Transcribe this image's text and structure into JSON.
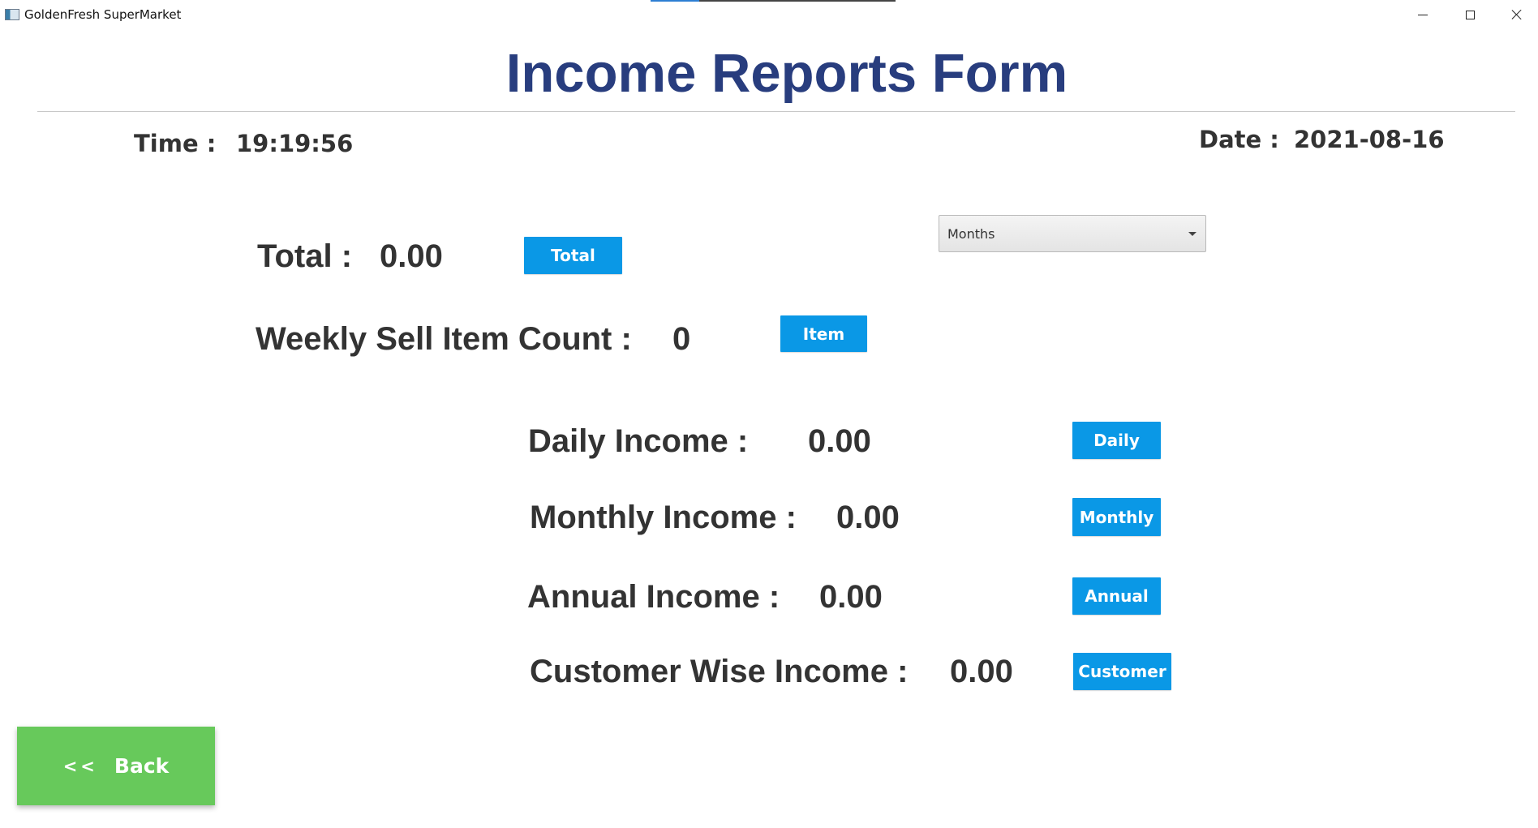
{
  "window": {
    "title": "GoldenFresh SuperMarket",
    "controls": {
      "minimize": "minimize-icon",
      "maximize": "maximize-icon",
      "close": "close-icon"
    }
  },
  "header": {
    "title": "Income Reports Form",
    "time_label": "Time  :",
    "time_value": "19:19:56",
    "date_label": "Date  :",
    "date_value": "2021-08-16"
  },
  "summary": {
    "total_label": "Total  :",
    "total_value": "0.00",
    "total_button": "Total",
    "weekly_label": "Weekly Sell Item Count :",
    "weekly_value": "0",
    "item_button": "Item"
  },
  "period_select": {
    "selected": "Months"
  },
  "income": {
    "daily_label": "Daily Income :",
    "daily_value": "0.00",
    "daily_button": "Daily",
    "monthly_label": "Monthly Income :",
    "monthly_value": "0.00",
    "monthly_button": "Monthly",
    "annual_label": "Annual Income :",
    "annual_value": "0.00",
    "annual_button": "Annual",
    "customer_label": "Customer Wise Income :",
    "customer_value": "0.00",
    "customer_button": "Customer"
  },
  "navigation": {
    "back_arrows": "<<",
    "back_label": "Back"
  },
  "colors": {
    "title": "#283d7e",
    "button_blue": "#0a98e6",
    "back_green": "#67c95b",
    "text_dark": "#333333"
  }
}
